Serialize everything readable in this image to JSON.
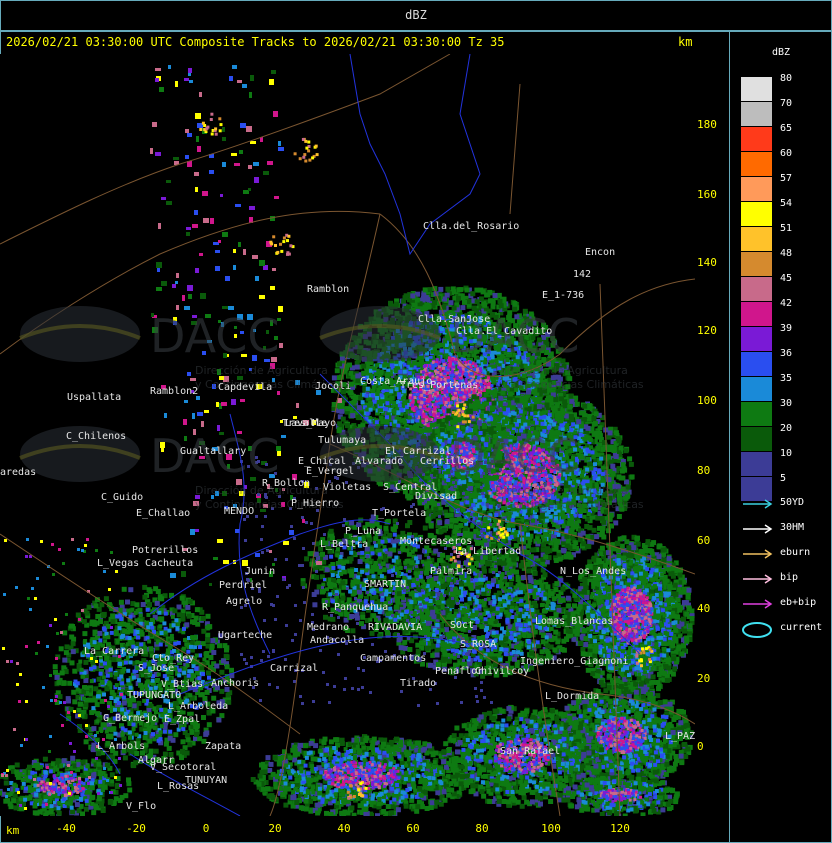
{
  "product_title": "dBZ",
  "header": {
    "text": "2026/02/21 03:30:00 UTC Composite Tracks to 2026/02/21 03:30:00 Tz 35",
    "unit": "km"
  },
  "y_axis": {
    "ticks": [
      "180",
      "160",
      "140",
      "120",
      "100",
      "80",
      "60",
      "40",
      "20",
      "0"
    ]
  },
  "x_axis": {
    "unit": "km",
    "ticks": [
      "-40",
      "-20",
      "0",
      "20",
      "40",
      "60",
      "80",
      "100",
      "120"
    ]
  },
  "legend": {
    "title": "dBZ",
    "entries": [
      {
        "label": "80",
        "color": "#e0e0e0"
      },
      {
        "label": "70",
        "color": "#bdbdbd"
      },
      {
        "label": "65",
        "color": "#ff3a1a"
      },
      {
        "label": "60",
        "color": "#ff6a00"
      },
      {
        "label": "57",
        "color": "#ff9a5a"
      },
      {
        "label": "54",
        "color": "#ffff00"
      },
      {
        "label": "51",
        "color": "#ffc22a"
      },
      {
        "label": "48",
        "color": "#d58a2e"
      },
      {
        "label": "45",
        "color": "#c86a8a"
      },
      {
        "label": "42",
        "color": "#d0168c"
      },
      {
        "label": "39",
        "color": "#7a1ad6"
      },
      {
        "label": "36",
        "color": "#2a4ef0"
      },
      {
        "label": "35",
        "color": "#1a8ad8"
      },
      {
        "label": "30",
        "color": "#0e7a12"
      },
      {
        "label": "20",
        "color": "#0a5a0a"
      },
      {
        "label": "10",
        "color": "#3c3c96"
      },
      {
        "label": "5",
        "color": "#3c3c96"
      }
    ],
    "tracks": [
      {
        "label": "50YD",
        "color": "#3ad0e0"
      },
      {
        "label": "30HM",
        "color": "#ffffff"
      },
      {
        "label": "eburn",
        "color": "#f0c060"
      },
      {
        "label": "bip",
        "color": "#ffc0e0"
      },
      {
        "label": "eb+bip",
        "color": "#e040e0"
      },
      {
        "label": "current",
        "color": "#40e0f0"
      }
    ]
  },
  "places": [
    {
      "name": "Clla.del_Rosario"
    },
    {
      "name": "Encon"
    },
    {
      "name": "142"
    },
    {
      "name": "E_1-736"
    },
    {
      "name": "Ramblon"
    },
    {
      "name": "Clla.SanJose"
    },
    {
      "name": "Clla.El_Cavadito"
    },
    {
      "name": "Uspallata"
    },
    {
      "name": "C_Chilenos"
    },
    {
      "name": "aredas"
    },
    {
      "name": "C_Guido"
    },
    {
      "name": "E_Challao"
    },
    {
      "name": "MENDO"
    },
    {
      "name": "Potrerillos"
    },
    {
      "name": "L_Vegas"
    },
    {
      "name": "Cacheuta"
    },
    {
      "name": "Perdriel"
    },
    {
      "name": "Agrelo"
    },
    {
      "name": "Ugarteche"
    },
    {
      "name": "La_Carrera"
    },
    {
      "name": "Cto_Rey"
    },
    {
      "name": "S_Jose"
    },
    {
      "name": "V_Btias"
    },
    {
      "name": "Anchoris"
    },
    {
      "name": "TUPUNGATO"
    },
    {
      "name": "L_Arboleda"
    },
    {
      "name": "E_Zpal"
    },
    {
      "name": "G_Bermejo"
    },
    {
      "name": "L_Arbols"
    },
    {
      "name": "Zapata"
    },
    {
      "name": "Algarr"
    },
    {
      "name": "V_Secotoral"
    },
    {
      "name": "TUNUYAN"
    },
    {
      "name": "L_Rosas"
    },
    {
      "name": "V_Flo"
    },
    {
      "name": "Tulumaya"
    },
    {
      "name": "Tres_Mayo"
    },
    {
      "name": "E_Chical"
    },
    {
      "name": "E_Vergel"
    },
    {
      "name": "R_Bollon"
    },
    {
      "name": "P_Hierro"
    },
    {
      "name": "Violetas"
    },
    {
      "name": "S_Central"
    },
    {
      "name": "T_Portela"
    },
    {
      "name": "Divisad"
    },
    {
      "name": "L_Beltra"
    },
    {
      "name": "SMARTIN"
    },
    {
      "name": "R_Panquehua"
    },
    {
      "name": "Medrano"
    },
    {
      "name": "RIVADAVIA"
    },
    {
      "name": "SOct"
    },
    {
      "name": "S_ROSA"
    },
    {
      "name": "Lomas_Blancas"
    },
    {
      "name": "Campamentos"
    },
    {
      "name": "Tirado"
    },
    {
      "name": "Carrizal"
    },
    {
      "name": "Andacolla"
    },
    {
      "name": "L_Dormida"
    },
    {
      "name": "L_PAZ"
    },
    {
      "name": "Lavalle"
    },
    {
      "name": "Costa_Araujo"
    },
    {
      "name": "Capdevila"
    },
    {
      "name": "Jocoli"
    },
    {
      "name": "Tres_Portenas"
    },
    {
      "name": "Alvarado"
    },
    {
      "name": "El_Carrizal"
    },
    {
      "name": "Cerrillos"
    },
    {
      "name": "Junin"
    },
    {
      "name": "Montecaseros"
    },
    {
      "name": "La_Libertad"
    },
    {
      "name": "P_Luna"
    },
    {
      "name": "Palmira"
    },
    {
      "name": "Ingeniero_Giagnoni"
    },
    {
      "name": "Chivilcoy"
    },
    {
      "name": "N_Los_Andes"
    },
    {
      "name": "San_Rafael"
    },
    {
      "name": "Penaflor"
    },
    {
      "name": "Ramblon2"
    },
    {
      "name": "Gualtallary"
    }
  ],
  "watermark": {
    "brand": "DACC",
    "tagline_1": "Dirección de Agricultura",
    "tagline_2": "y Contingencias Climáticas"
  }
}
